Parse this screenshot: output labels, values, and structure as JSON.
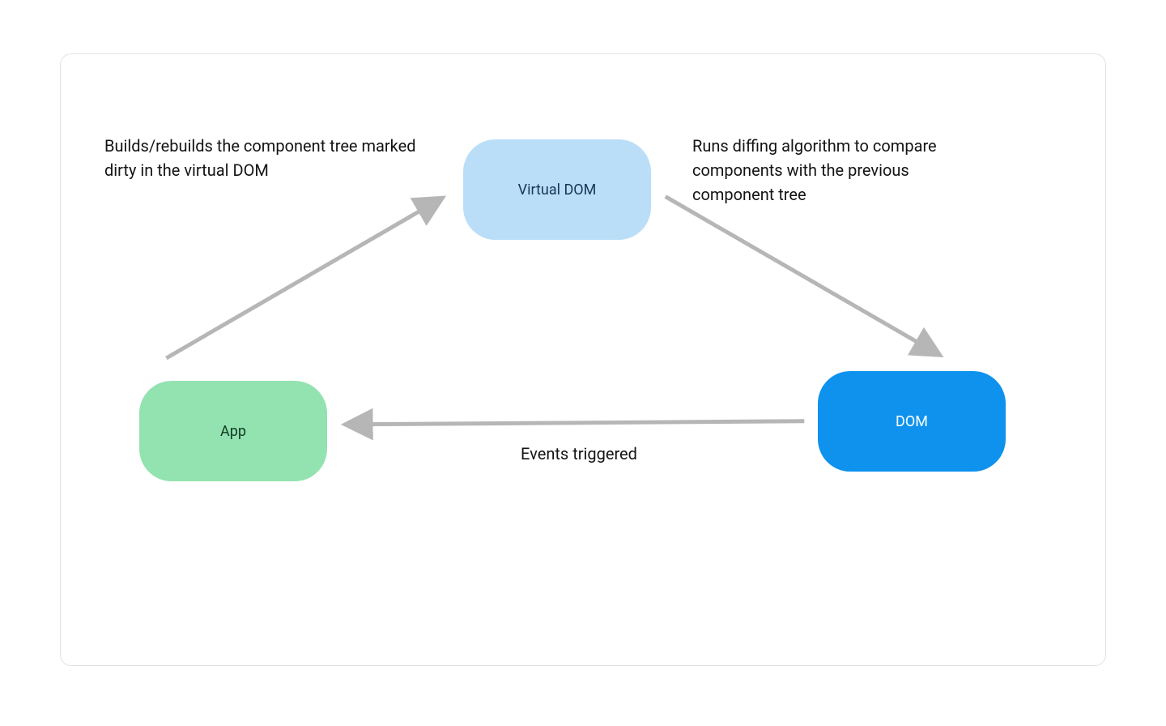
{
  "diagram": {
    "nodes": {
      "virtual_dom": {
        "label": "Virtual DOM",
        "color": "#bbdef8"
      },
      "app": {
        "label": "App",
        "color": "#93e3b0"
      },
      "dom": {
        "label": "DOM",
        "color": "#0e92ed"
      }
    },
    "annotations": {
      "build_rebuild": "Builds/rebuilds the component tree marked dirty in the virtual DOM",
      "diffing": "Runs diffing algorithm to compare components with the previous component tree",
      "events": "Events triggered"
    },
    "edges": [
      {
        "from": "app",
        "to": "virtual_dom",
        "label_ref": "build_rebuild"
      },
      {
        "from": "virtual_dom",
        "to": "dom",
        "label_ref": "diffing"
      },
      {
        "from": "dom",
        "to": "app",
        "label_ref": "events"
      }
    ],
    "colors": {
      "arrow": "#b6b6b6",
      "border": "#e1e1e1"
    }
  }
}
